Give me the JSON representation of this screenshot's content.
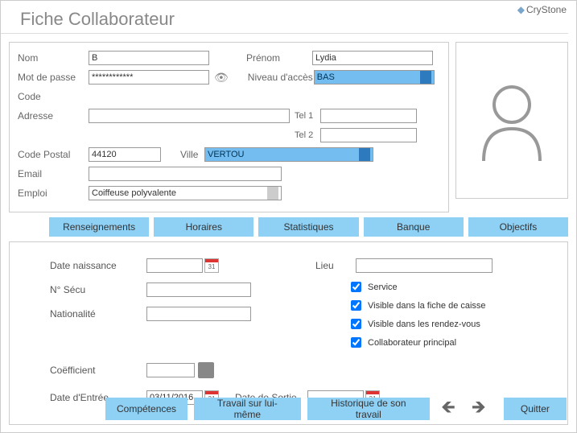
{
  "brand": "CryStone",
  "title": "Fiche Collaborateur",
  "labels": {
    "nom": "Nom",
    "prenom": "Prénom",
    "mdp": "Mot de passe",
    "niveau": "Niveau d'accès",
    "code": "Code",
    "adresse": "Adresse",
    "tel1": "Tel 1",
    "tel2": "Tel 2",
    "cp": "Code Postal",
    "ville": "Ville",
    "email": "Email",
    "emploi": "Emploi"
  },
  "values": {
    "nom": "B",
    "prenom": "Lydia",
    "mdp": "************",
    "niveau": "BAS",
    "code": "",
    "adresse": "",
    "tel1": "",
    "tel2": "",
    "cp": "44120",
    "ville": "VERTOU",
    "email": "",
    "emploi": "Coiffeuse polyvalente"
  },
  "tabs": {
    "renseignements": "Renseignements",
    "horaires": "Horaires",
    "statistiques": "Statistiques",
    "banque": "Banque",
    "objectifs": "Objectifs"
  },
  "detail": {
    "date_naissance_lbl": "Date naissance",
    "date_naissance": "",
    "lieu_lbl": "Lieu",
    "lieu": "",
    "secu_lbl": "N° Sécu",
    "secu": "",
    "nationalite_lbl": "Nationalité",
    "nationalite": "",
    "coef_lbl": "Coëfficient",
    "coef": "",
    "entree_lbl": "Date d'Entrée",
    "entree": "03/11/2016",
    "sortie_lbl": "Date de Sortie",
    "sortie": "",
    "cal_num": "31",
    "chk_service": "Service",
    "chk_caisse": "Visible dans la fiche de caisse",
    "chk_rdv": "Visible dans les rendez-vous",
    "chk_principal": "Collaborateur principal"
  },
  "footer": {
    "competences": "Compétences",
    "travail": "Travail sur lui-même",
    "historique": "Historique de son travail",
    "quitter": "Quitter"
  }
}
